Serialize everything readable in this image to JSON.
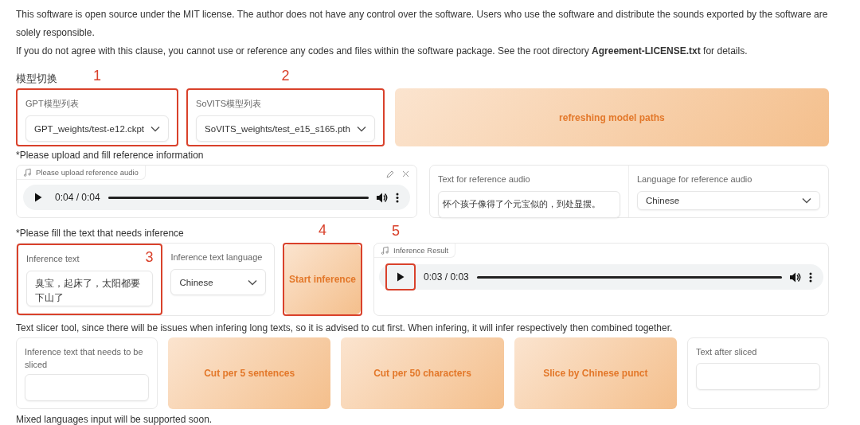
{
  "notice": [
    "This software is open source under the MIT license. The author does not have any control over the software. Users who use the software and distribute the sounds exported by the software are solely responsible.",
    "If you do not agree with this clause, you cannot use or reference any codes and files within the software package. See the root directory **Agreement-LICENSE.txt** for details."
  ],
  "model_section": {
    "title": "模型切换",
    "gpt": {
      "label": "GPT模型列表",
      "value": "GPT_weights/test-e12.ckpt",
      "annotation": "1"
    },
    "sovits": {
      "label": "SoVITS模型列表",
      "value": "SoVITS_weights/test_e15_s165.pth",
      "annotation": "2"
    },
    "refresh_button": {
      "label": "refreshing model paths"
    }
  },
  "reference": {
    "heading": "*Please upload and fill reference information",
    "audio": {
      "label": "Please upload reference audio",
      "time": "0:04 / 0:04",
      "level": 1
    },
    "text": {
      "label": "Text for reference audio",
      "value": "怀个孩子像得了个元宝似的，到处显摆。"
    },
    "language": {
      "label": "Language for reference audio",
      "value": "Chinese"
    }
  },
  "inference": {
    "heading": "*Please fill the text that needs inference",
    "text": {
      "label": "Inference text",
      "value": "臭宝，起床了，太阳都要下山了",
      "annotation": "3"
    },
    "language": {
      "label": "Inference text language",
      "value": "Chinese"
    },
    "start_button": {
      "label": "Start inference",
      "annotation": "4"
    },
    "result": {
      "label": "Inference Result",
      "time": "0:03 / 0:03",
      "level": 1,
      "play_annotation": "5"
    }
  },
  "slicer": {
    "heading": "Text slicer tool, since there will be issues when infering long texts, so it is advised to cut first. When infering, it will infer respectively then combined together.",
    "input": {
      "label": "Inference text that needs to be sliced"
    },
    "buttons": [
      "Cut per 5 sentences",
      "Cut per 50 characters",
      "Slice by Chinese punct"
    ],
    "output": {
      "label": "Text after sliced"
    }
  },
  "footer": "Mixed languages input will be supported soon."
}
